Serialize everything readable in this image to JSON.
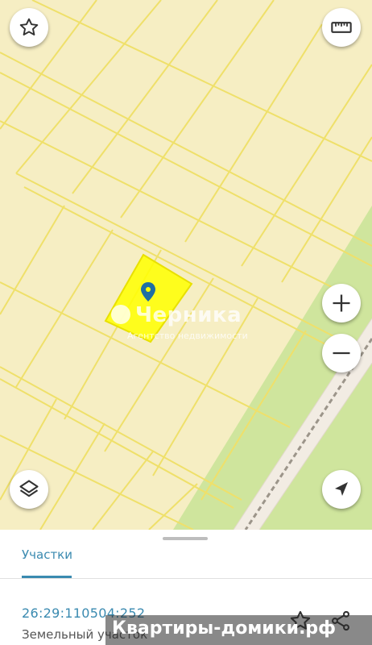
{
  "map": {
    "watermark_title": "Черника",
    "watermark_subtitle": "Агентство недвижимости",
    "colors": {
      "land": "#f6eec3",
      "parcel_line": "#efe06a",
      "selected_parcel": "#ffff00",
      "green_strip": "#cfe59d",
      "pin": "#1f6fa3"
    }
  },
  "controls": {
    "favorite": "star-icon",
    "ruler": "ruler-icon",
    "zoom_in": "plus-icon",
    "zoom_out": "minus-icon",
    "layers": "layers-icon",
    "locate": "navigation-arrow-icon"
  },
  "sheet": {
    "tab_label": "Участки",
    "cadastral_number": "26:29:110504:252",
    "land_type": "Земельный участок"
  },
  "brand": {
    "text": "Квартиры-домики.рф"
  }
}
